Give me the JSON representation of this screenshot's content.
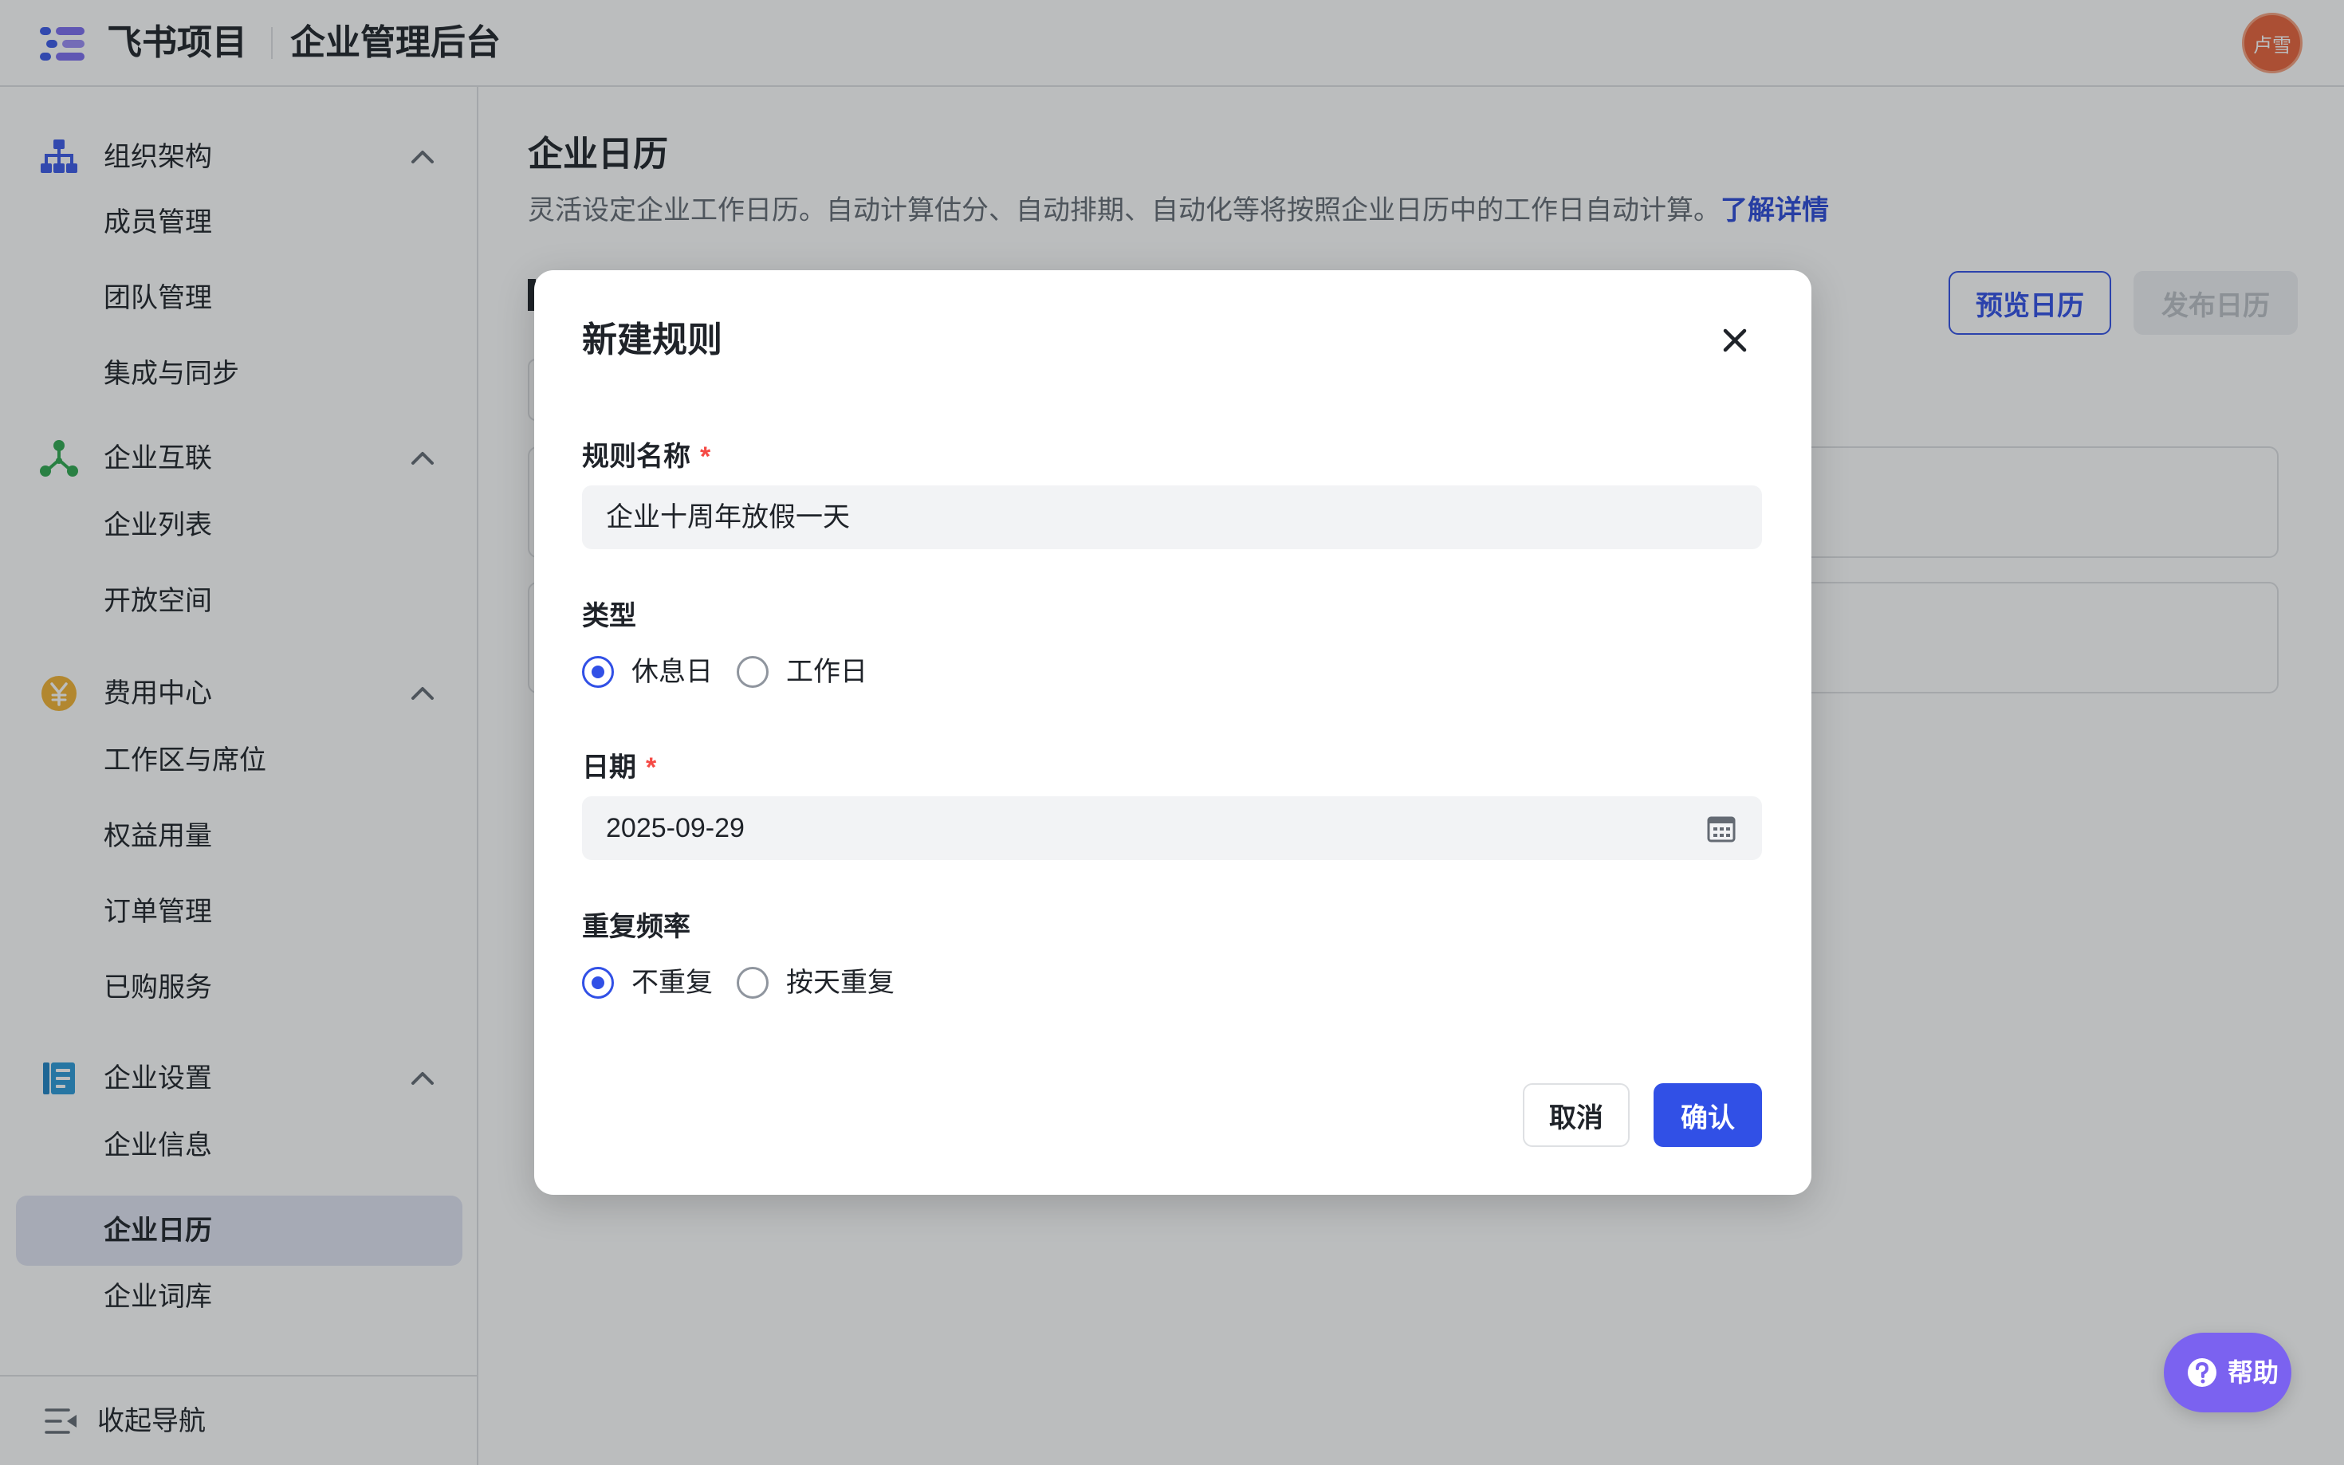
{
  "header": {
    "brand": "飞书项目",
    "admin_title": "企业管理后台",
    "avatar_text": "卢雪",
    "avatar_color": "#e8623a"
  },
  "sidebar": {
    "groups": [
      {
        "label": "组织架构",
        "icon": "org-chart-icon",
        "items": [
          "成员管理",
          "团队管理",
          "集成与同步"
        ]
      },
      {
        "label": "企业互联",
        "icon": "network-icon",
        "items": [
          "企业列表",
          "开放空间"
        ]
      },
      {
        "label": "费用中心",
        "icon": "yen-coin-icon",
        "items": [
          "工作区与席位",
          "权益用量",
          "订单管理",
          "已购服务"
        ]
      },
      {
        "label": "企业设置",
        "icon": "settings-doc-icon",
        "items": [
          "企业信息",
          "企业日历",
          "企业词库"
        ]
      }
    ],
    "active_item": "企业日历",
    "collapse_label": "收起导航"
  },
  "main": {
    "title": "企业日历",
    "description": "灵活设定企业工作日历。自动计算估分、自动排期、自动化等将按照企业日历中的工作日自动计算。",
    "learn_more": "了解详情",
    "preview_button": "预览日历",
    "publish_button": "发布日历"
  },
  "dialog": {
    "title": "新建规则",
    "name_label": "规则名称",
    "required_mark": "*",
    "name_value": "企业十周年放假一天",
    "type_label": "类型",
    "type_options": [
      "休息日",
      "工作日"
    ],
    "type_selected": "休息日",
    "date_label": "日期",
    "date_value": "2025-09-29",
    "repeat_label": "重复频率",
    "repeat_options": [
      "不重复",
      "按天重复"
    ],
    "repeat_selected": "不重复",
    "cancel_button": "取消",
    "confirm_button": "确认"
  },
  "help": {
    "label": "帮助"
  },
  "colors": {
    "accent": "#3150e6",
    "link": "#2b49d9",
    "required": "#f54a45",
    "help": "#7b62f0",
    "active_nav_bg": "#e1e4f3"
  }
}
